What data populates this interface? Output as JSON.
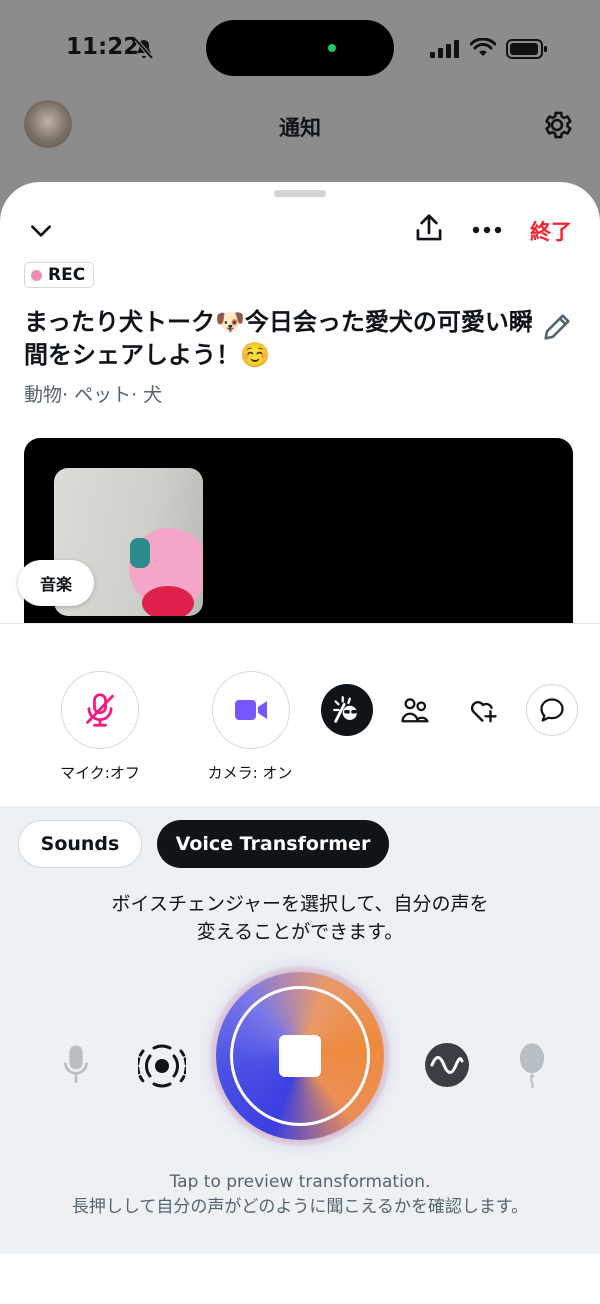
{
  "status": {
    "time": "11:22"
  },
  "background": {
    "title": "通知"
  },
  "space": {
    "end_label": "終了",
    "rec_label": "REC",
    "title": "まったり犬トーク🐶今日会った愛犬の可愛い瞬間をシェアしよう！☺️",
    "topics": "動物· ペット· 犬",
    "music_pill": "音楽"
  },
  "controls": {
    "mic_label": "マイク:オフ",
    "camera_label": "カメラ: オン"
  },
  "panel": {
    "tabs": [
      {
        "label": "Sounds",
        "selected": false
      },
      {
        "label": "Voice Transformer",
        "selected": true
      }
    ],
    "description_line1": "ボイスチェンジャーを選択して、自分の声を",
    "description_line2": "変えることができます。",
    "hint_line1": "Tap to preview transformation.",
    "hint_line2": "長押しして自分の声がどのように聞こえるかを確認します。"
  },
  "colors": {
    "accent_end": "#f4212e",
    "camera_accent": "#7856ff",
    "mic_off": "#f91880",
    "rec_dot": "#f58ab6"
  },
  "icons": [
    "bell-off-icon",
    "signal-icon",
    "wifi-icon",
    "battery-icon",
    "gear-icon",
    "chevron-down-icon",
    "share-icon",
    "more-icon",
    "pencil-icon",
    "mic-off-icon",
    "video-camera-icon",
    "voice-effect-icon",
    "people-icon",
    "heart-plus-icon",
    "chat-icon",
    "microphone-icon",
    "vibrate-voice-icon",
    "stop-icon",
    "wave-icon",
    "balloon-icon"
  ]
}
